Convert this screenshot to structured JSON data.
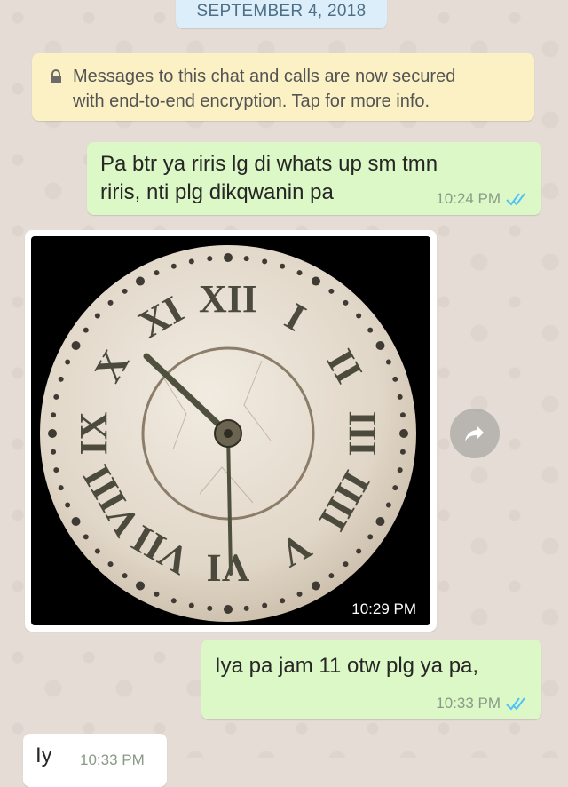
{
  "chat": {
    "date_chip": "SEPTEMBER 4, 2018",
    "encryption_notice": {
      "icon": "lock-icon",
      "line1": "Messages to this chat and calls are now secured",
      "line2": "with end-to-end encryption. Tap for more info."
    },
    "messages": [
      {
        "direction": "outgoing",
        "line1": "Pa btr ya riris lg di whats up sm tmn",
        "line2": "riris, nti plg dikqwanin pa",
        "time": "10:24 PM",
        "status_icon": "double-check-icon"
      },
      {
        "direction": "incoming",
        "type": "image",
        "image_description": "clock-face-photo",
        "time": "10:29 PM",
        "action_icon": "forward-icon"
      },
      {
        "direction": "outgoing",
        "line1": "Iya pa jam 11 otw plg ya pa,",
        "time": "10:33 PM",
        "status_icon": "double-check-icon"
      },
      {
        "direction": "incoming",
        "line1": "Iy",
        "time": "10:33 PM"
      }
    ]
  },
  "colors": {
    "outgoing_bubble": "#dcf8c6",
    "incoming_bubble": "#ffffff",
    "background": "#e5ddd5",
    "read_ticks": "#4fc3f7"
  }
}
